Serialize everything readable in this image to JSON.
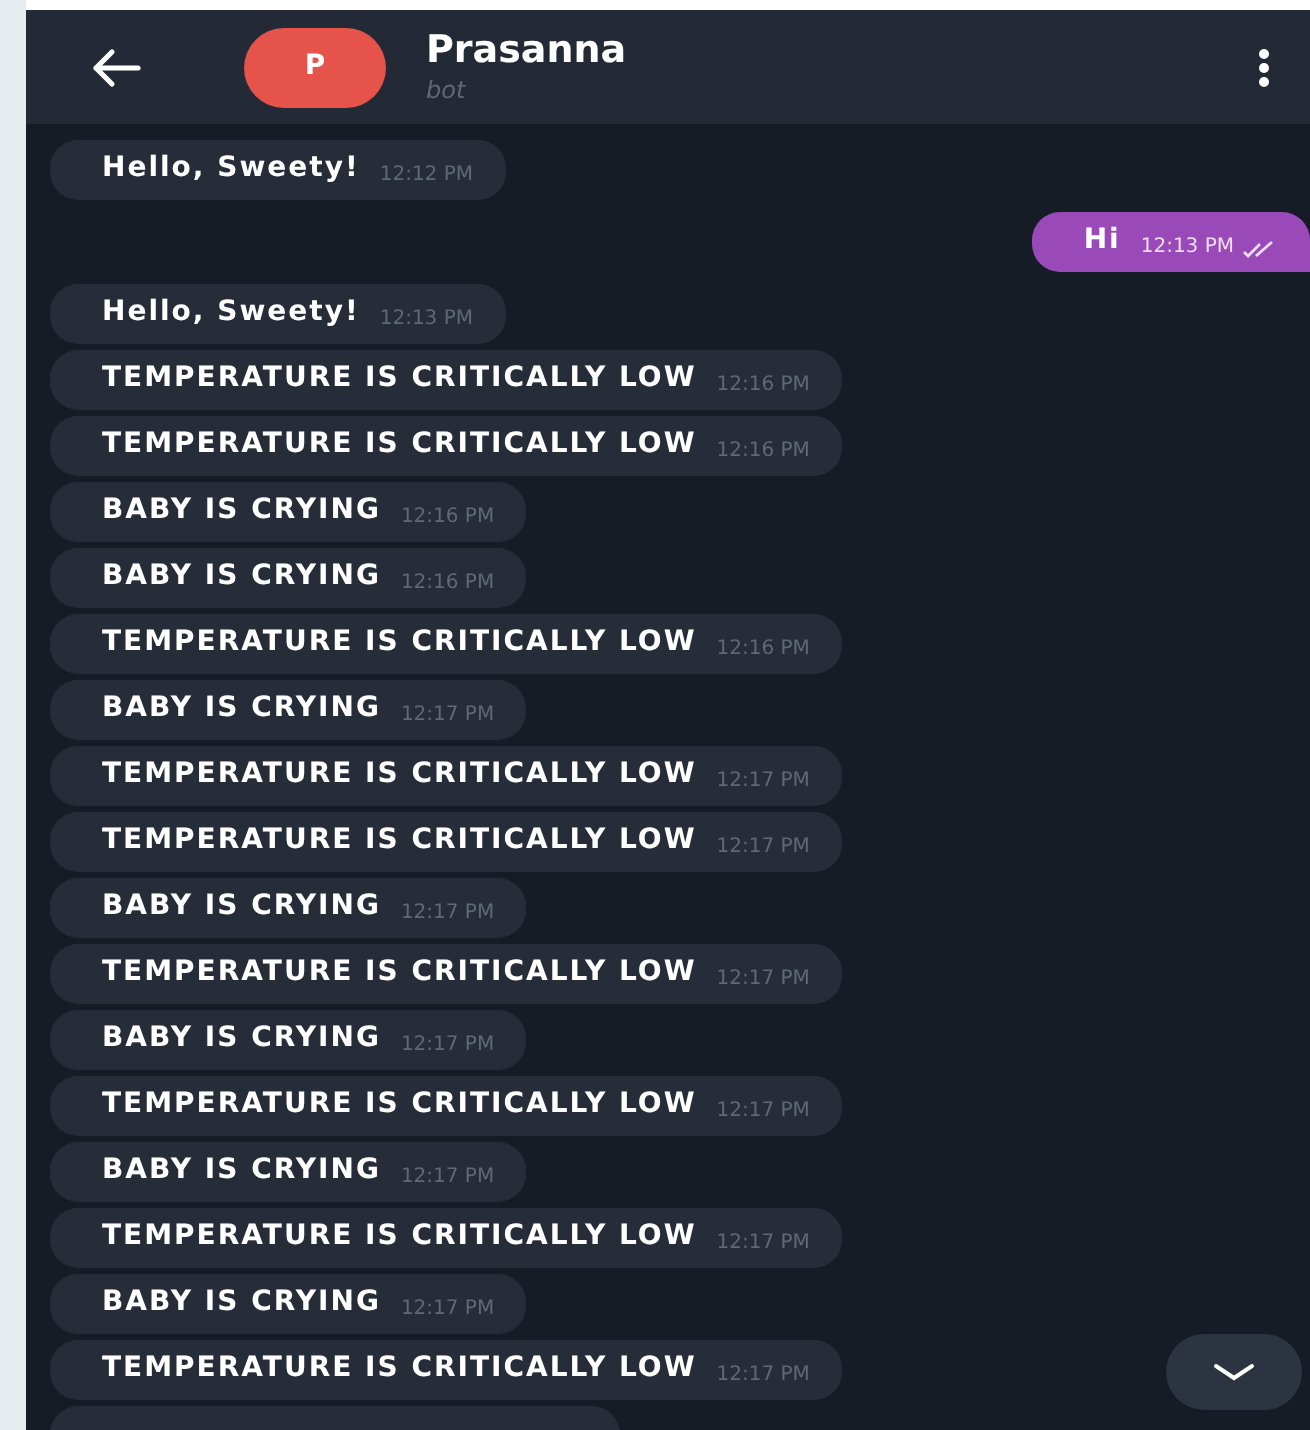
{
  "header": {
    "avatar_letter": "P",
    "title": "Prasanna",
    "subtitle": "bot"
  },
  "messages": [
    {
      "kind": "incoming",
      "text": "Hello, Sweety!",
      "time": "12:12 PM"
    },
    {
      "kind": "outgoing",
      "text": "Hi",
      "time": "12:13 PM",
      "read": true
    },
    {
      "kind": "incoming",
      "text": "Hello, Sweety!",
      "time": "12:13 PM"
    },
    {
      "kind": "incoming",
      "text": "TEMPERATURE IS CRITICALLY LOW",
      "time": "12:16 PM"
    },
    {
      "kind": "incoming",
      "text": "TEMPERATURE IS CRITICALLY LOW",
      "time": "12:16 PM"
    },
    {
      "kind": "incoming",
      "text": "BABY IS CRYING",
      "time": "12:16 PM"
    },
    {
      "kind": "incoming",
      "text": "BABY IS CRYING",
      "time": "12:16 PM"
    },
    {
      "kind": "incoming",
      "text": "TEMPERATURE IS CRITICALLY LOW",
      "time": "12:16 PM"
    },
    {
      "kind": "incoming",
      "text": "BABY IS CRYING",
      "time": "12:17 PM"
    },
    {
      "kind": "incoming",
      "text": "TEMPERATURE IS CRITICALLY LOW",
      "time": "12:17 PM"
    },
    {
      "kind": "incoming",
      "text": "TEMPERATURE IS CRITICALLY LOW",
      "time": "12:17 PM"
    },
    {
      "kind": "incoming",
      "text": "BABY IS CRYING",
      "time": "12:17 PM"
    },
    {
      "kind": "incoming",
      "text": "TEMPERATURE IS CRITICALLY LOW",
      "time": "12:17 PM"
    },
    {
      "kind": "incoming",
      "text": "BABY IS CRYING",
      "time": "12:17 PM"
    },
    {
      "kind": "incoming",
      "text": "TEMPERATURE IS CRITICALLY LOW",
      "time": "12:17 PM"
    },
    {
      "kind": "incoming",
      "text": "BABY IS CRYING",
      "time": "12:17 PM"
    },
    {
      "kind": "incoming",
      "text": "TEMPERATURE IS CRITICALLY LOW",
      "time": "12:17 PM"
    },
    {
      "kind": "incoming",
      "text": "BABY IS CRYING",
      "time": "12:17 PM"
    },
    {
      "kind": "incoming",
      "text": "TEMPERATURE IS CRITICALLY LOW",
      "time": "12:17 PM"
    }
  ]
}
